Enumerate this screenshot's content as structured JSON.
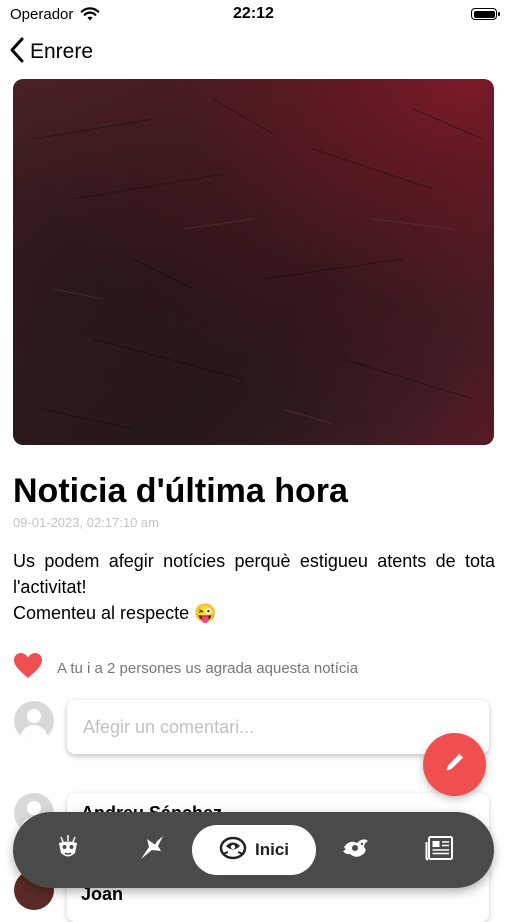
{
  "status_bar": {
    "carrier": "Operador",
    "time": "22:12"
  },
  "nav_header": {
    "back_label": "Enrere"
  },
  "article": {
    "title": "Noticia d'última hora",
    "date": "09-01-2023, 02:17:10 am",
    "body_line1": "Us podem afegir notícies perquè estigueu atents de tota l'activitat!",
    "body_line2": "Comenteu al respecte 😜",
    "likes_text": "A tu i a 2 persones us agrada aquesta notícia"
  },
  "comment_input": {
    "placeholder": "Afegir un comentari..."
  },
  "comments": [
    {
      "author": "Andreu Sánchez"
    },
    {
      "author": "Joan"
    }
  ],
  "tab_bar": {
    "items": [
      {
        "icon": "mask-icon"
      },
      {
        "icon": "bird-icon"
      },
      {
        "icon": "logo-icon",
        "label": "Inici",
        "active": true
      },
      {
        "icon": "dragon-icon"
      },
      {
        "icon": "newspaper-icon"
      }
    ]
  },
  "colors": {
    "accent": "#f04f4f",
    "heart": "#f04f4f",
    "tabbar": "#4a4a4a"
  }
}
